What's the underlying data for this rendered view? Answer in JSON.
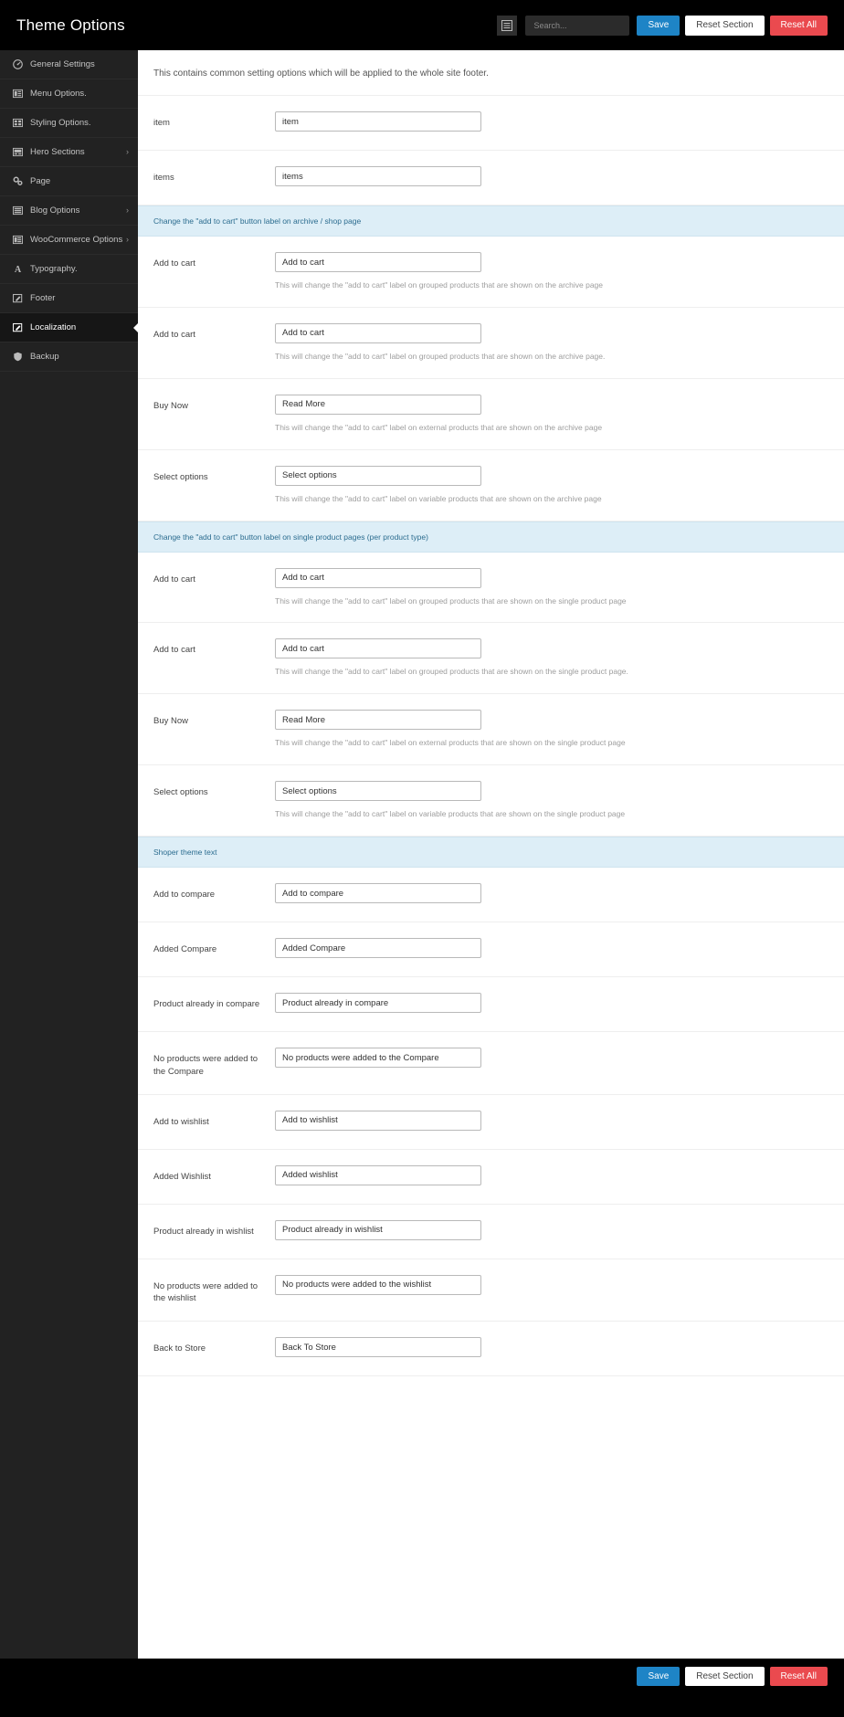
{
  "topbar": {
    "title": "Theme Options",
    "menu_icon": "list-icon",
    "search_placeholder": "Search...",
    "search_value": "",
    "save_label": "Save",
    "reset_section_label": "Reset Section",
    "reset_all_label": "Reset All",
    "save_color": "#1e84c6",
    "reset_all_color": "#ea4a4f"
  },
  "sidebar": {
    "items": [
      {
        "label": "General Settings",
        "icon": "dashboard-icon",
        "active": false,
        "arrow": ""
      },
      {
        "label": "Menu Options.",
        "icon": "menu-grid-icon",
        "active": false,
        "arrow": ""
      },
      {
        "label": "Styling Options.",
        "icon": "styling-grid-icon",
        "active": false,
        "arrow": ""
      },
      {
        "label": "Hero Sections",
        "icon": "slider-icon",
        "active": false,
        "arrow": "›"
      },
      {
        "label": "Page",
        "icon": "gears-icon",
        "active": false,
        "arrow": ""
      },
      {
        "label": "Blog Options",
        "icon": "list-block-icon",
        "active": false,
        "arrow": "›"
      },
      {
        "label": "WooCommerce Options",
        "icon": "cart-block-icon",
        "active": false,
        "arrow": "›"
      },
      {
        "label": "Typography.",
        "icon": "font-a-icon",
        "active": false,
        "arrow": ""
      },
      {
        "label": "Footer",
        "icon": "pencil-square-icon",
        "active": false,
        "arrow": ""
      },
      {
        "label": "Localization",
        "icon": "pencil-square-icon",
        "active": true,
        "arrow": ""
      },
      {
        "label": "Backup",
        "icon": "shield-icon",
        "active": false,
        "arrow": ""
      }
    ]
  },
  "main": {
    "intro": "This contains common setting options which will be applied to the whole site footer.",
    "blocks": [
      {
        "kind": "field",
        "label": "item",
        "value": "item",
        "help": ""
      },
      {
        "kind": "field",
        "label": "items",
        "value": "items",
        "help": ""
      },
      {
        "kind": "section",
        "label": "Change the \"add to cart\" button label on archive / shop page"
      },
      {
        "kind": "field",
        "label": "Add to cart",
        "value": "Add to cart",
        "help": "This will change the \"add to cart\" label on grouped products that are shown on the archive page"
      },
      {
        "kind": "field",
        "label": "Add to cart",
        "value": "Add to cart",
        "help": "This will change the \"add to cart\" label on grouped products that are shown on the archive page."
      },
      {
        "kind": "field",
        "label": "Buy Now",
        "value": "Read More",
        "help": "This will change the \"add to cart\" label on external products that are shown on the archive page"
      },
      {
        "kind": "field",
        "label": "Select options",
        "value": "Select options",
        "help": "This will change the \"add to cart\" label on variable products that are shown on the archive page"
      },
      {
        "kind": "section",
        "label": "Change the \"add to cart\" button label on single product pages (per product type)"
      },
      {
        "kind": "field",
        "label": "Add to cart",
        "value": "Add to cart",
        "help": "This will change the \"add to cart\" label on grouped products that are shown on the single product page"
      },
      {
        "kind": "field",
        "label": "Add to cart",
        "value": "Add to cart",
        "help": "This will change the \"add to cart\" label on grouped products that are shown on the single product page."
      },
      {
        "kind": "field",
        "label": "Buy Now",
        "value": "Read More",
        "help": "This will change the \"add to cart\" label on external products that are shown on the single product page"
      },
      {
        "kind": "field",
        "label": "Select options",
        "value": "Select options",
        "help": "This will change the \"add to cart\" label on variable products that are shown on the single product page"
      },
      {
        "kind": "section",
        "label": "Shoper theme text"
      },
      {
        "kind": "field",
        "label": "Add to compare",
        "value": "Add to compare",
        "help": ""
      },
      {
        "kind": "field",
        "label": "Added Compare",
        "value": "Added Compare",
        "help": ""
      },
      {
        "kind": "field",
        "label": "Product already in compare",
        "value": "Product already in compare",
        "help": ""
      },
      {
        "kind": "field",
        "label": "No products were added to the Compare",
        "value": "No products were added to the Compare",
        "help": ""
      },
      {
        "kind": "field",
        "label": "Add to wishlist",
        "value": "Add to wishlist",
        "help": ""
      },
      {
        "kind": "field",
        "label": "Added Wishlist",
        "value": "Added wishlist",
        "help": ""
      },
      {
        "kind": "field",
        "label": "Product already in wishlist",
        "value": "Product already in wishlist",
        "help": ""
      },
      {
        "kind": "field",
        "label": "No products were added to the wishlist",
        "value": "No products were added to the wishlist",
        "help": ""
      },
      {
        "kind": "field",
        "label": "Back to Store",
        "value": "Back To Store",
        "help": ""
      }
    ]
  },
  "footerbar": {
    "save_label": "Save",
    "reset_section_label": "Reset Section",
    "reset_all_label": "Reset All"
  }
}
